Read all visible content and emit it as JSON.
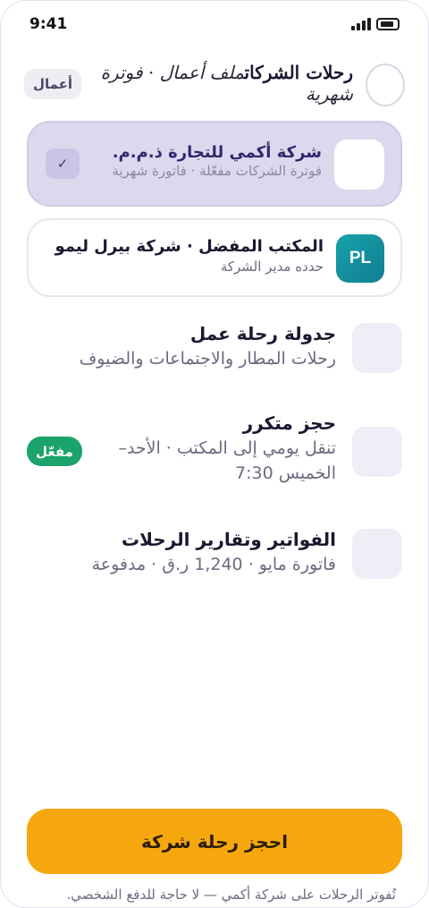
{
  "status_bar": {
    "time": "9:41"
  },
  "header": {
    "title": "رحلات الشركات",
    "subtitle": "ملف أعمال · فوترة شهرية",
    "mode_chip": "أعمال"
  },
  "company_card": {
    "name": "شركة أكمي للتجارة ذ.م.م.",
    "subtitle": "فوترة الشركات مفعّلة · فاتورة شهرية",
    "check": "✓"
  },
  "chauffeur_card": {
    "badge": "PL",
    "name": "المكتب المفضل · شركة بيرل ليمو",
    "subtitle": "حدده مدير الشركة"
  },
  "menu": [
    {
      "title": "جدولة رحلة عمل",
      "subtitle": "رحلات المطار والاجتماعات والضيوف"
    },
    {
      "title": "حجز متكرر",
      "subtitle": "تنقل يومي إلى المكتب · الأحد–الخميس 7:30",
      "badge": "مفعّل"
    },
    {
      "title": "الفواتير وتقارير الرحلات",
      "subtitle": "فاتورة مايو · 1,240 ر.ق · مدفوعة"
    }
  ],
  "cta": {
    "label": "احجز رحلة شركة"
  },
  "footnote": "تُفوتر الرحلات على شركة أكمي — لا حاجة للدفع الشخصي.",
  "colors": {
    "accent": "#f6a70e",
    "company_card_bg": "#ddd8ee",
    "badge_teal": "#16a2a8",
    "enabled_green": "#1aa36a"
  }
}
